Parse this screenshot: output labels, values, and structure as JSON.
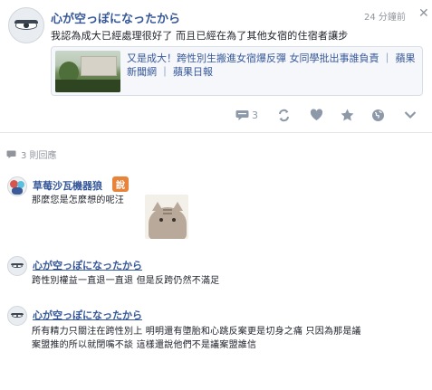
{
  "post": {
    "author": "心が空っぽになったから",
    "time": "24 分鐘前",
    "close_glyph": "✕",
    "text": "我認為成大已經處理很好了 而且已經在為了其他女宿的住宿者讓步",
    "link": {
      "title": "又是成大！跨性別生搬進女宿爆反彈 女同學批出事誰負責",
      "sep1": "｜",
      "source1": "蘋果新聞網",
      "sep2": "｜",
      "source2": "蘋果日報"
    },
    "actions": {
      "comment_count": "3",
      "icons": [
        "comment-icon",
        "share-icon",
        "heart-icon",
        "star-icon",
        "globe-icon",
        "chevron-down-icon"
      ]
    }
  },
  "replies": {
    "count_label": "3 則回應"
  },
  "comments": [
    {
      "author": "草莓沙瓦機器狼",
      "tag": "說",
      "text": "那麼您是怎麼想的呢汪"
    },
    {
      "author": "心が空っぽになったから",
      "text": "跨性別權益一直退一直退 但是反跨仍然不滿足"
    },
    {
      "author": "心が空っぽになったから",
      "text_line1": "所有精力只關注在跨性別上 明明還有墮胎和心跳反案更是切身之痛 只因為那是議",
      "text_line2": "案盟推的所以就閉嘴不談 這樣還說他們不是議案盟誰信"
    }
  ],
  "colors": {
    "link": "#365899",
    "muted": "#90949c",
    "icon": "#8d98a8",
    "tag": "#e8833a",
    "card_bg": "#f6f7fb"
  }
}
